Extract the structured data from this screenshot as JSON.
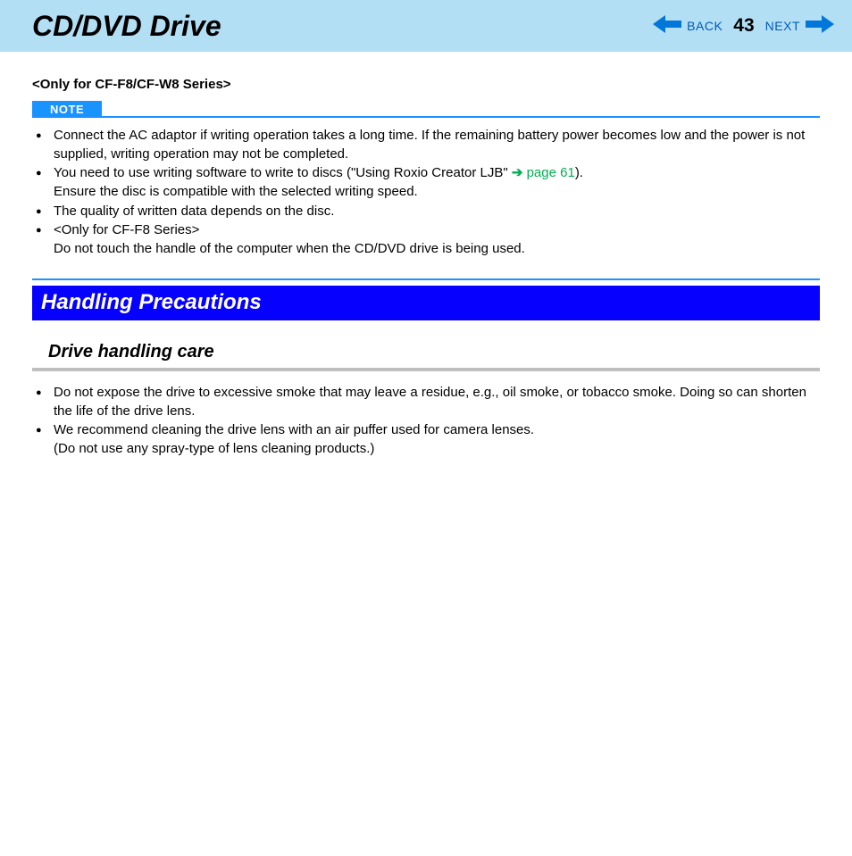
{
  "header": {
    "title": "CD/DVD Drive",
    "back_label": "BACK",
    "page_number": "43",
    "next_label": "NEXT"
  },
  "subtitle": "<Only for CF-F8/CF-W8 Series>",
  "note_label": "NOTE",
  "note_items": {
    "i1a": "Connect the AC adaptor if writing operation takes a long time. If the remaining battery power becomes low and the power is not supplied, writing operation may not be completed.",
    "i2a": "You need to use writing software to write to discs (\"Using Roxio Creator LJB\" ",
    "i2_link": "page 61",
    "i2b": ").",
    "i2c": "Ensure the disc is compatible with the selected writing speed.",
    "i3": "The quality of written data depends on the disc.",
    "i4a": "<Only for CF-F8 Series>",
    "i4b": "Do not touch the handle of the computer when the CD/DVD drive is being used."
  },
  "section_heading": "Handling Precautions",
  "sub_heading": "Drive handling care",
  "care_items": {
    "c1": "Do not expose the drive to excessive smoke that may leave a residue, e.g., oil smoke, or tobacco smoke. Doing so can shorten the life of the drive lens.",
    "c2a": "We recommend cleaning the drive lens with an air puffer used for camera lenses.",
    "c2b": "(Do not use any spray-type of lens cleaning products.)"
  }
}
